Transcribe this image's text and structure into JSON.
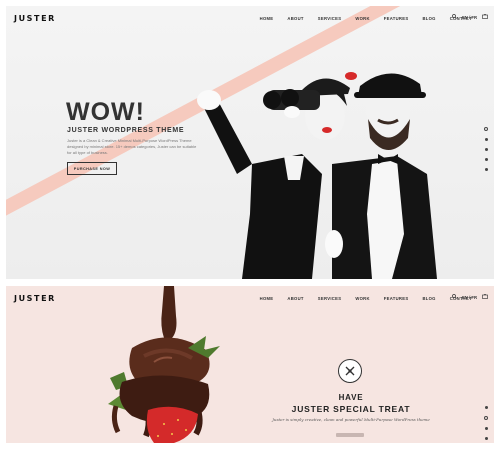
{
  "hero1": {
    "logo": "JUSTER",
    "nav": [
      "HOME",
      "ABOUT",
      "SERVICES",
      "WORK",
      "FEATURES",
      "BLOG",
      "CONTACT"
    ],
    "lang": "EN / FR",
    "heading": "WOW!",
    "subheading": "JUSTER WORDPRESS THEME",
    "description": "Juster is a Clean & Creative Minimal Multi-Purpose WordPress Theme designed by minimal store. 15+ demos categories, Juster can be suitable for all type of business.",
    "button": "PURCHASE NOW",
    "slider_dots": 5,
    "active_dot": 0
  },
  "hero2": {
    "logo": "JUSTER",
    "nav": [
      "HOME",
      "ABOUT",
      "SERVICES",
      "WORK",
      "FEATURES",
      "BLOG",
      "CONTACT"
    ],
    "lang": "EN / FR",
    "heading_line1": "HAVE",
    "heading_line2": "JUSTER SPECIAL TREAT",
    "description": "Juster is simply creative, clean and powerful Multi-Purpose WordPress theme",
    "slider_dots": 5,
    "active_dot": 1
  },
  "colors": {
    "accent_stripe": "#f6c7bb",
    "hero2_bg": "#f6e5e1",
    "text_dark": "#222222"
  }
}
